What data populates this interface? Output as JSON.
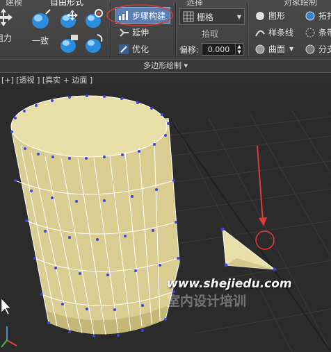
{
  "ribbon": {
    "top_tabs": [
      "建模",
      "自由形式",
      "选择",
      "对象绘制"
    ],
    "left_buttons": {
      "align_label": "阻力",
      "conform_label": "一致"
    },
    "step_build": "步骤构建",
    "extend": "延伸",
    "optimize": "优化",
    "grid_dropdown": "栅格",
    "pick": "拾取",
    "offset_label": "偏移:",
    "offset_value": "0.000",
    "shape": "图形",
    "spline": "样条线",
    "surface": "曲面",
    "topology": "拓扑",
    "strips": "条带",
    "branches": "分支",
    "group_title": "多边形绘制 ▾"
  },
  "viewport": {
    "header": "[+] [透视 ] [真实 + 边面 ]",
    "plus": "[+]",
    "view": "[透视 ]",
    "shading": "[真实 + 边面 ]"
  },
  "watermark": {
    "url": "www.shejiedu.com",
    "name": "室内设计培训"
  },
  "colors": {
    "mesh": "#e6dca1",
    "mesh_shade": "#c2b57a",
    "vertex": "#3a46e0",
    "highlight": "#e23a3a",
    "grid": "#3a3a3a"
  }
}
